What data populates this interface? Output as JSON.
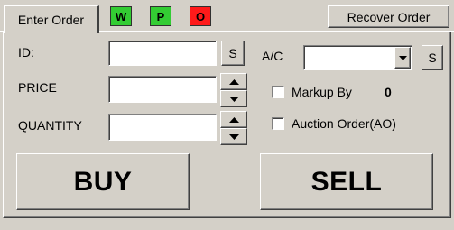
{
  "tabs": {
    "enter_order": "Enter Order"
  },
  "status_badges": [
    {
      "label": "W",
      "color": "#33cc33"
    },
    {
      "label": "P",
      "color": "#33cc33"
    },
    {
      "label": "O",
      "color": "#ff1a1a"
    }
  ],
  "header": {
    "recover_order": "Recover Order"
  },
  "form": {
    "id_label": "ID:",
    "id_value": "",
    "search_button": "S",
    "price_label": "PRICE",
    "price_value": "",
    "quantity_label": "QUANTITY",
    "quantity_value": "",
    "account_label": "A/C",
    "account_value": "",
    "account_search_button": "S",
    "markup_label": "Markup By",
    "markup_checked": false,
    "markup_value": "0",
    "auction_label": "Auction Order(AO)",
    "auction_checked": false
  },
  "actions": {
    "buy": "BUY",
    "sell": "SELL"
  }
}
